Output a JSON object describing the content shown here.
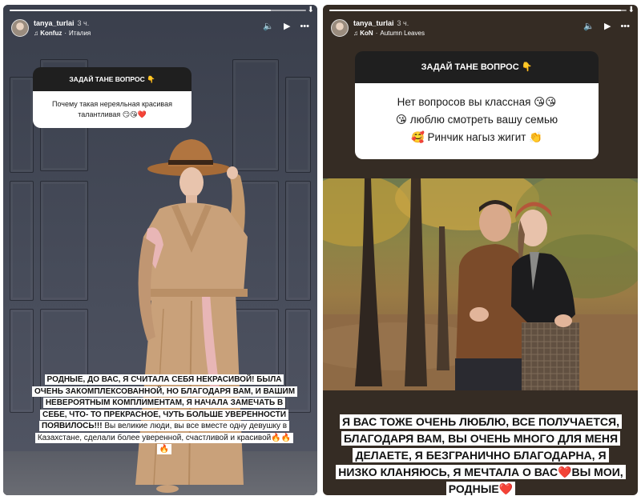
{
  "left_story": {
    "username": "tanya_turlai",
    "time": "3 ч.",
    "music_artist": "Konfuz",
    "music_track": "Италия",
    "question_header": "ЗАДАЙ ТАНЕ ВОПРОС 👇",
    "question_text": "Почему такая нереяльная красивая талантливая 😏😘❤️",
    "reply_bold": "РОДНЫЕ, ДО ВАС, Я СЧИТАЛА СЕБЯ НЕКРАСИВОЙ! БЫЛА ОЧЕНЬ ЗАКОМПЛЕКСОВАННОЙ, НО БЛАГОДАРЯ ВАМ, И ВАШИМ НЕВЕРОЯТНЫМ КОМПЛИМЕНТАМ, Я НАЧАЛА ЗАМЕЧАТЬ В СЕБЕ, ЧТО- ТО ПРЕКРАСНОЕ, ЧУТЬ БОЛЬШЕ УВЕРЕННОСТИ ПОЯВИЛОСЬ!!!",
    "reply_normal": "Вы великие люди, вы все вместе одну девушку в Казахстане, сделали более уверенной, счастливой и красивой🔥🔥🔥",
    "progress": 0.88
  },
  "right_story": {
    "username": "tanya_turlai",
    "time": "3 ч.",
    "music_artist": "KoN",
    "music_track": "Autumn Leaves",
    "question_header": "ЗАДАЙ ТАНЕ ВОПРОС 👇",
    "question_line1": "Нет вопросов вы классная 😘😘",
    "question_line2": "😘 люблю смотреть вашу семью",
    "question_line3": "🥰 Ринчик нагыз жигит 👏",
    "reply": "Я ВАС ТОЖЕ ОЧЕНЬ ЛЮБЛЮ, ВСЕ ПОЛУЧАЕТСЯ, БЛАГОДАРЯ ВАМ, ВЫ ОЧЕНЬ МНОГО ДЛЯ МЕНЯ ДЕЛАЕТЕ, Я БЕЗГРАНИЧНО БЛАГОДАРНА, Я НИЗКО КЛАНЯЮСЬ, Я МЕЧТАЛА О ВАС❤️ВЫ МОИ, РОДНЫЕ❤️",
    "progress": 0.98
  },
  "icons": {
    "note": "♫",
    "volume": "🔈",
    "play": "▶",
    "more": "•••",
    "download": "⬇"
  }
}
